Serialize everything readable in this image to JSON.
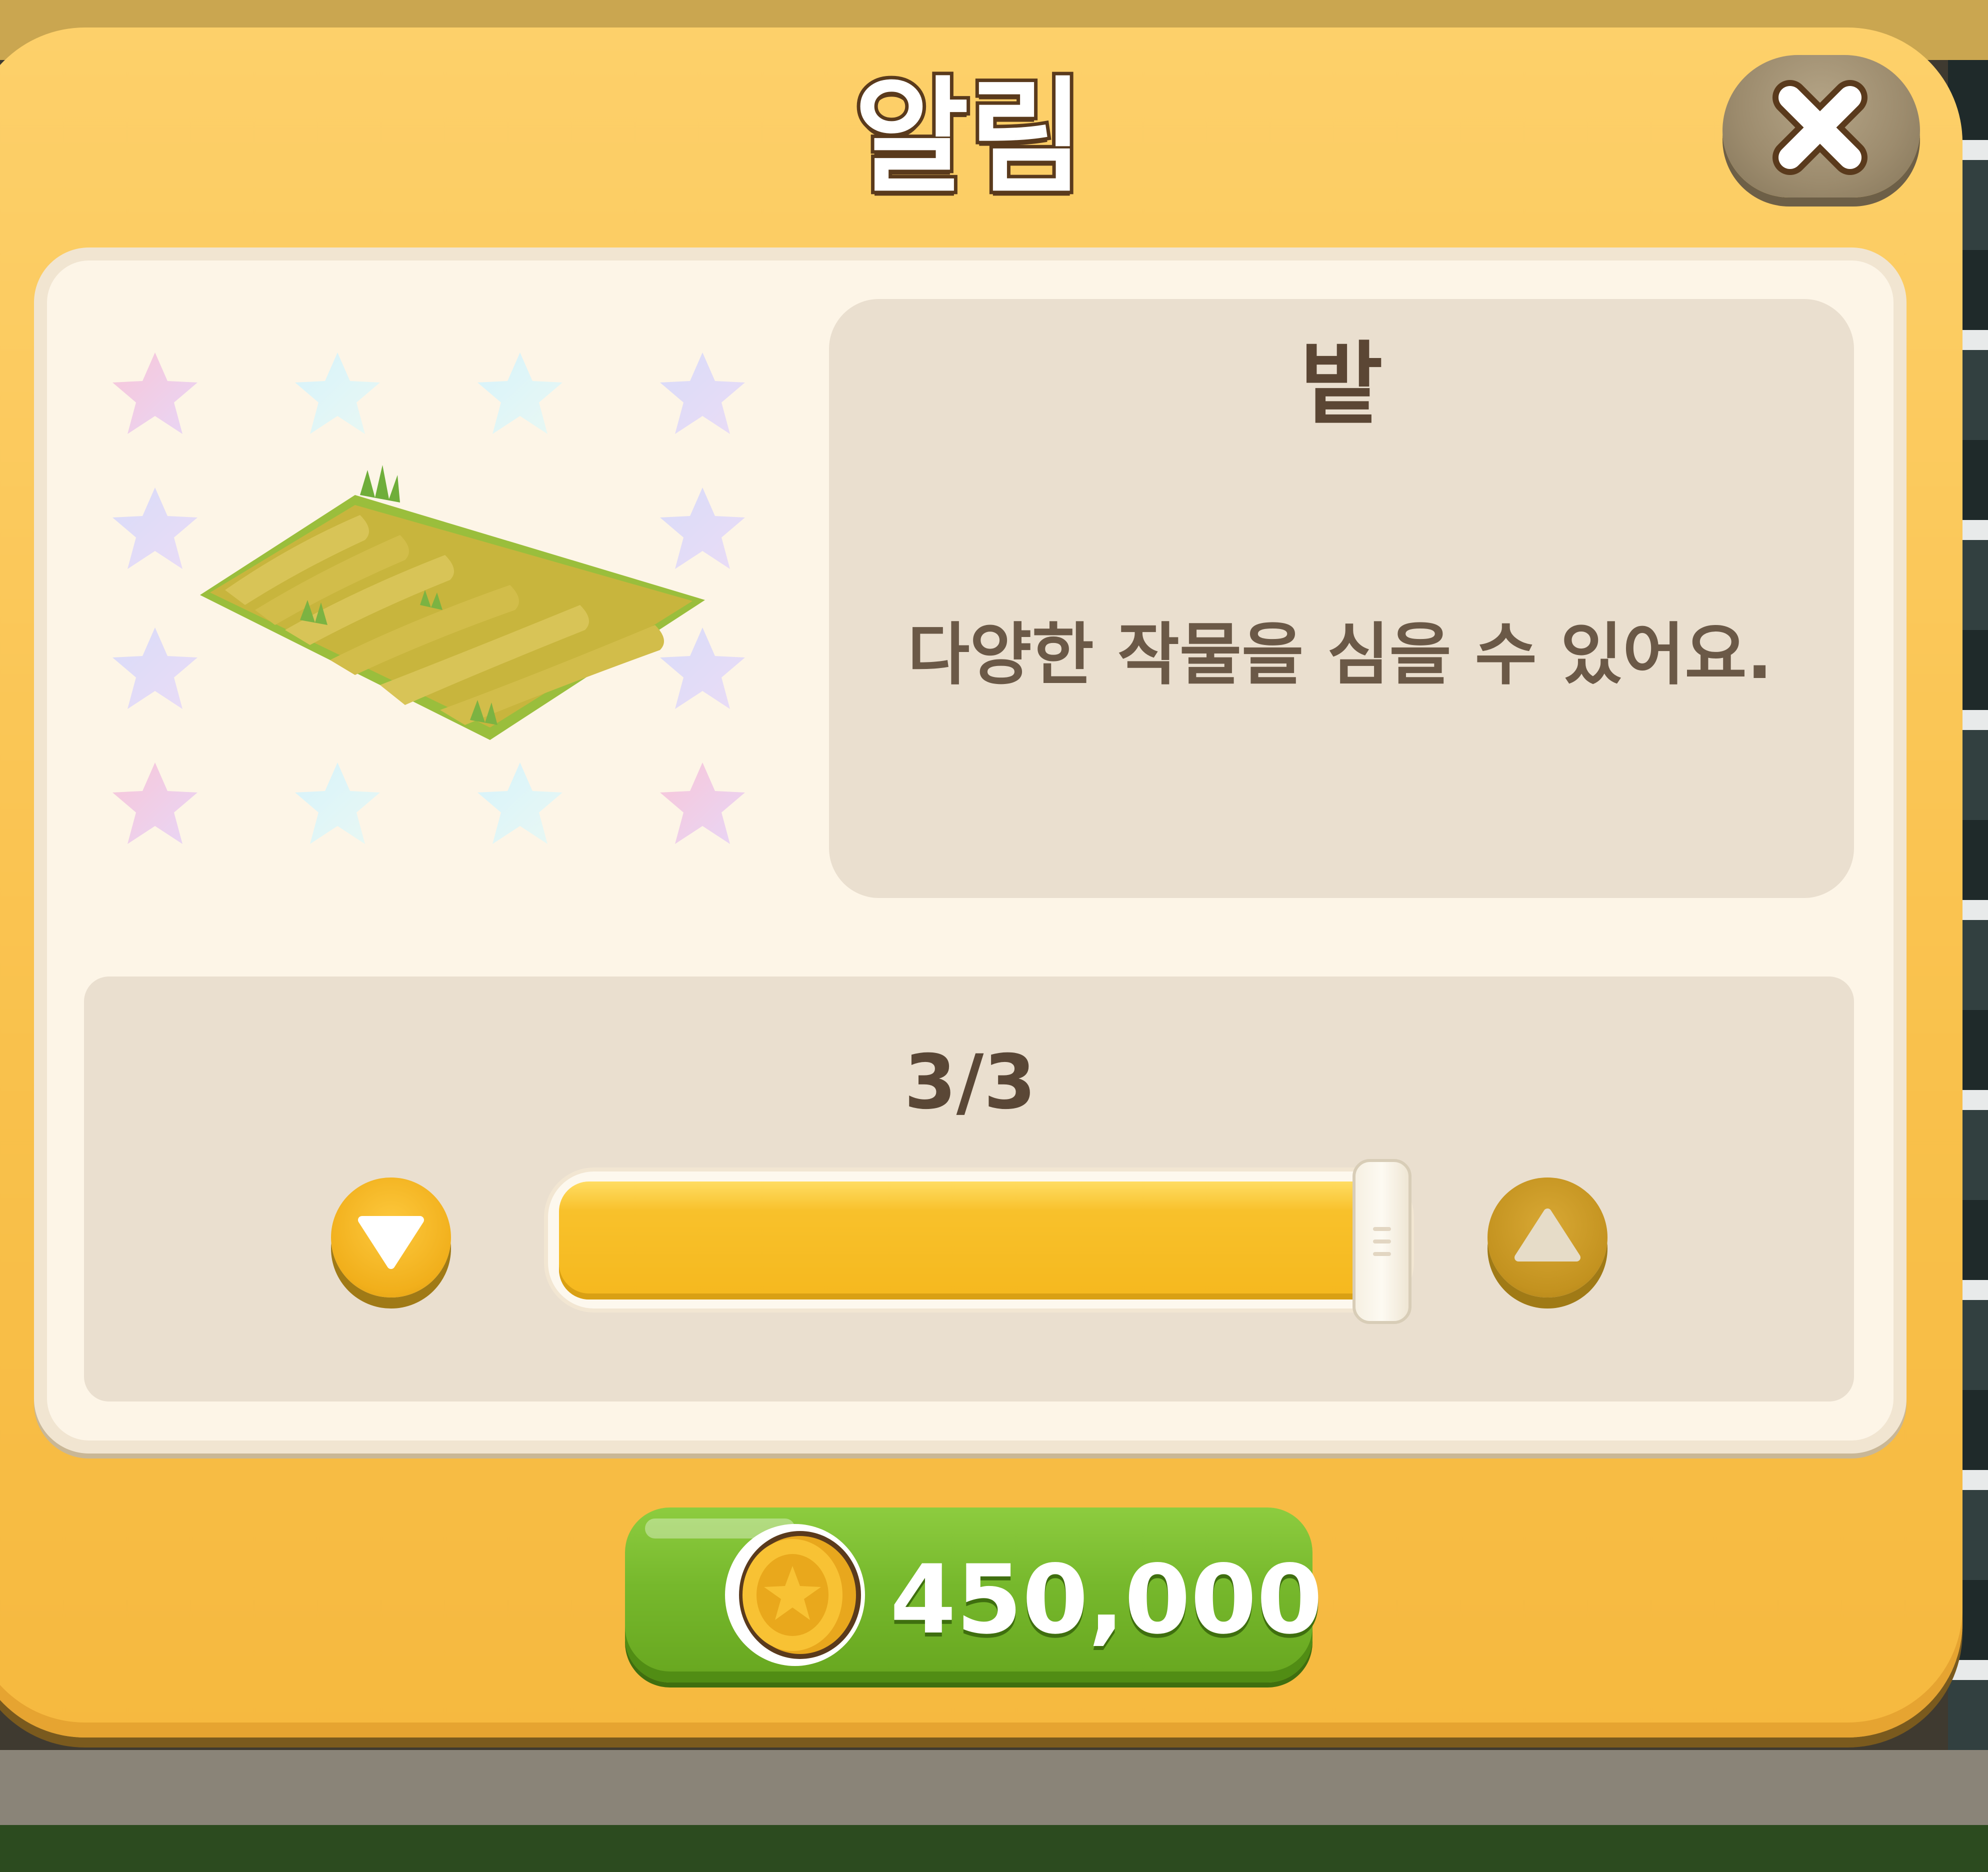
{
  "dialog": {
    "title": "알림",
    "close_icon": "close-icon"
  },
  "item": {
    "name": "밭",
    "description": "다양한 작물을 심을 수 있어요.",
    "image_icon": "crop-field-tile"
  },
  "quantity": {
    "display": "3/3",
    "current": 3,
    "max": 3,
    "slider_fill_fraction": 1.0,
    "decrease_icon": "triangle-down-icon",
    "increase_icon": "triangle-up-icon"
  },
  "purchase": {
    "price": "450,000",
    "currency_icon": "gold-coin-icon"
  },
  "colors": {
    "dialog_bg": "#f9c14c",
    "panel_bg": "#fdf5e7",
    "box_bg": "#eadfcf",
    "slider_fill": "#f5b81e",
    "buy_button": "#76b82c",
    "text_brown": "#5b4634"
  }
}
